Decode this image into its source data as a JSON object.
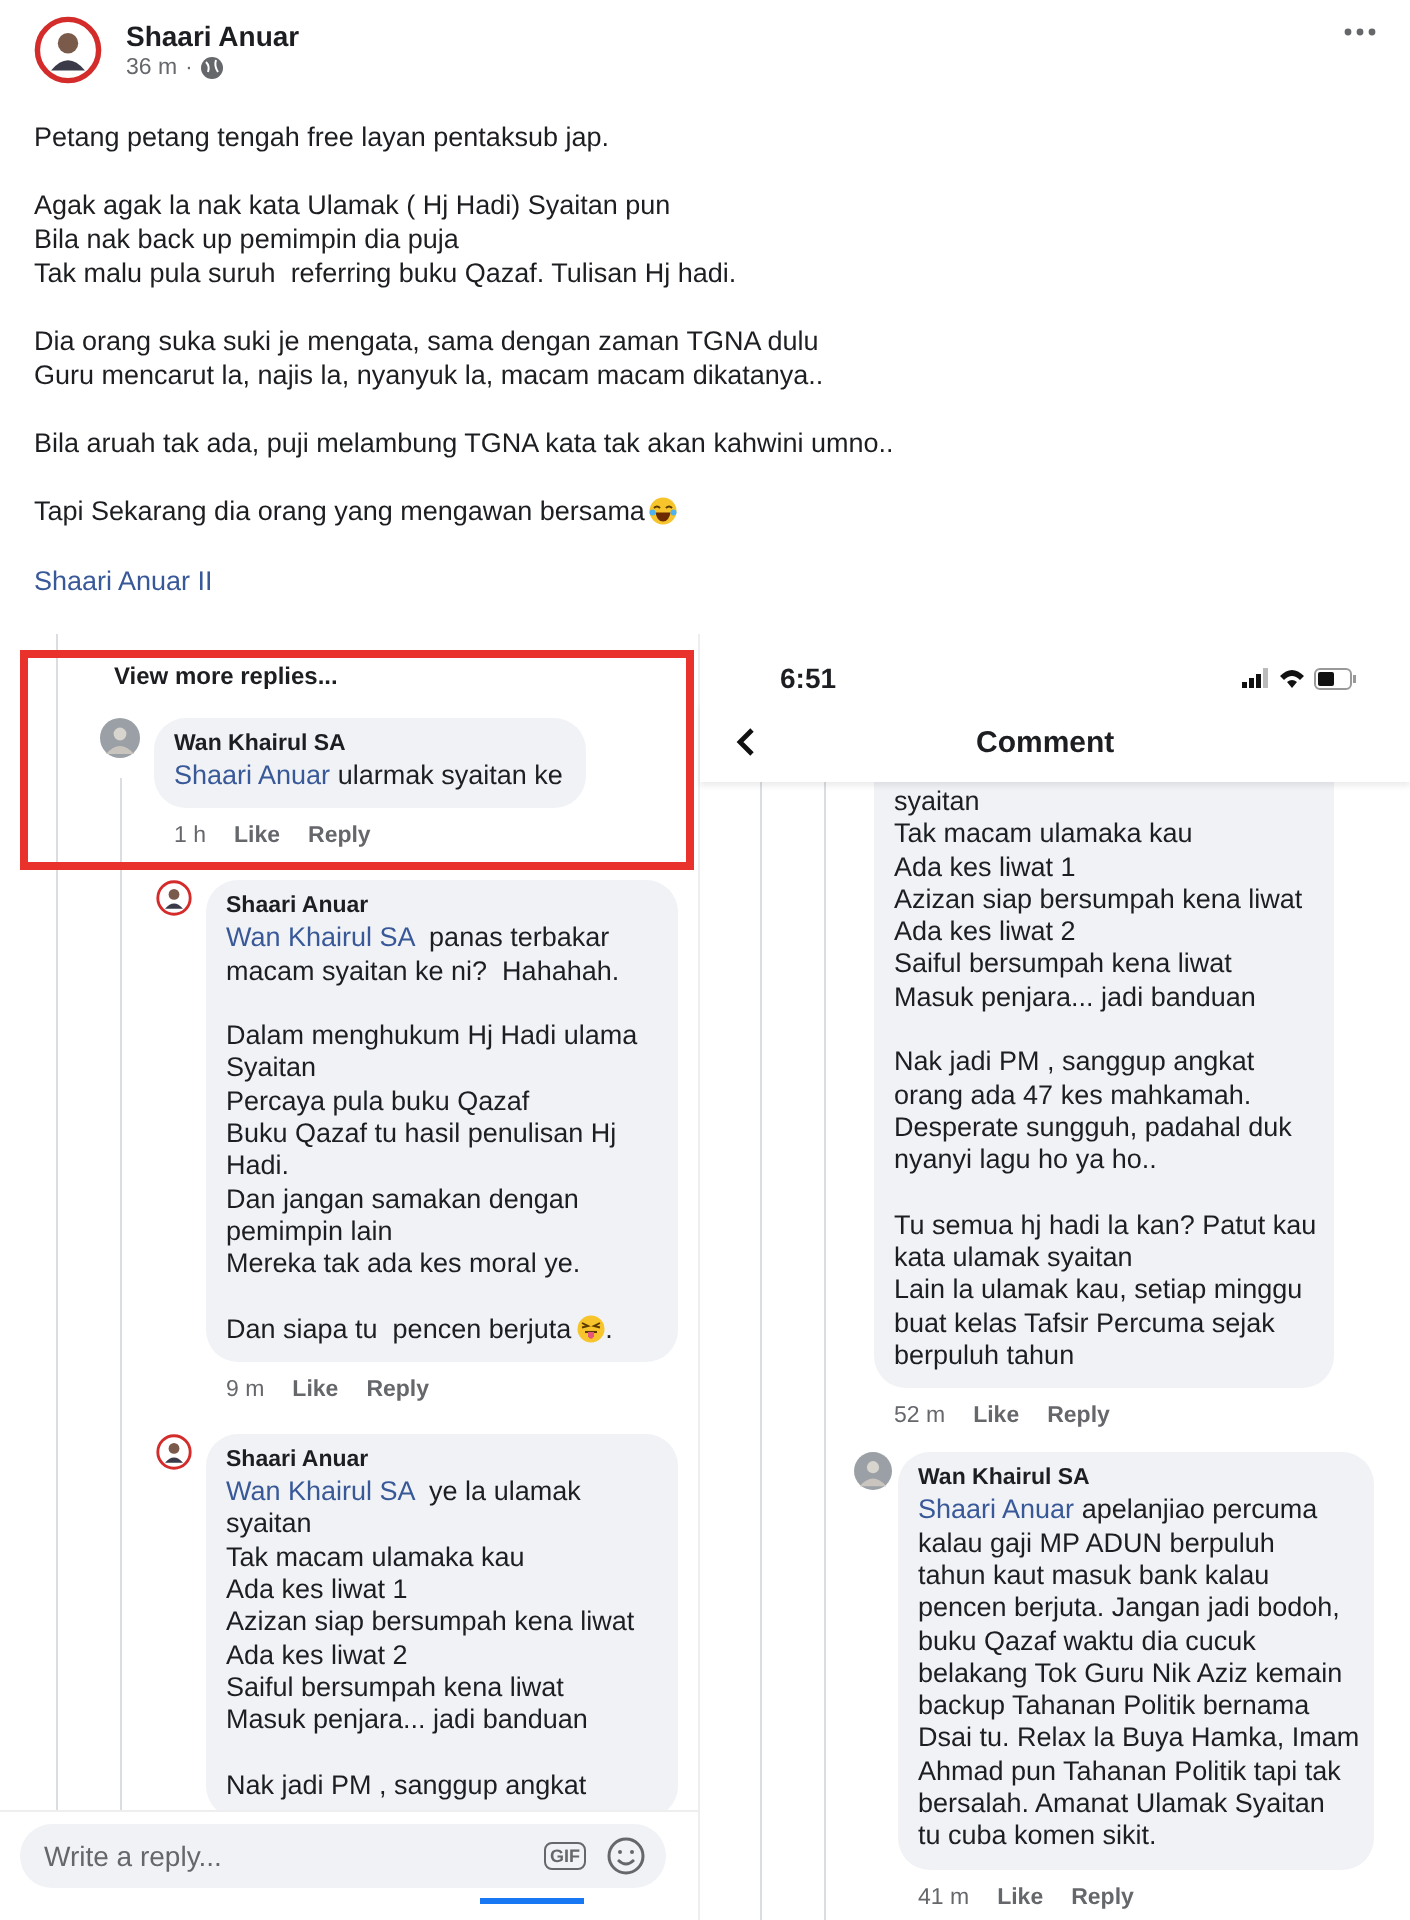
{
  "post": {
    "author": "Shaari Anuar",
    "time": "36 m",
    "separator": "·",
    "paragraphs": [
      {
        "lines": [
          "Petang petang tengah free layan pentaksub jap."
        ]
      },
      {
        "lines": [
          "Agak agak la nak kata Ulamak ( Hj Hadi) Syaitan pun",
          "Bila nak back up pemimpin dia puja",
          "Tak malu pula suruh  referring buku Qazaf. Tulisan Hj hadi."
        ]
      },
      {
        "lines": [
          "Dia orang suka suki je mengata, sama dengan zaman TGNA dulu",
          "Guru mencarut la, najis la, nyanyuk la, macam macam dikatanya.."
        ]
      },
      {
        "lines": [
          "Bila aruah tak ada, puji melambung TGNA kata tak akan kahwini umno.."
        ]
      },
      {
        "lines": [
          "Tapi Sekarang dia orang yang mengawan bersama"
        ],
        "emoji": {
          "kind": "laughing"
        }
      }
    ],
    "link": "Shaari Anuar II"
  },
  "left_screenshot": {
    "view_more": "View more replies...",
    "highlighted": true,
    "comments": [
      {
        "author": "Wan Khairul SA",
        "avatar": {
          "kind": "photo"
        },
        "mention": "Shaari Anuar",
        "paragraphs": [
          {
            "lines": [
              " ularmak syaitan ke"
            ]
          }
        ],
        "time": "1 h",
        "actions": [
          "Like",
          "Reply"
        ],
        "replies": [
          {
            "author": "Shaari Anuar",
            "avatar": {
              "kind": "ring"
            },
            "mention": "Wan Khairul SA",
            "paragraphs": [
              {
                "lines": [
                  "  panas terbakar",
                  "macam syaitan ke ni?  Hahahah."
                ]
              },
              {
                "lines": [
                  "Dalam menghukum Hj Hadi ulama",
                  "Syaitan",
                  "Percaya pula buku Qazaf",
                  "Buku Qazaf tu hasil penulisan Hj",
                  "Hadi.",
                  "Dan jangan samakan dengan",
                  "pemimpin lain",
                  "Mereka tak ada kes moral ye."
                ]
              },
              {
                "lines": [
                  "Dan siapa tu  pencen berjuta"
                ],
                "emoji": {
                  "kind": "tongue"
                },
                "tail": "."
              }
            ],
            "time": "9 m",
            "actions": [
              "Like",
              "Reply"
            ]
          },
          {
            "author": "Shaari Anuar",
            "avatar": {
              "kind": "ring"
            },
            "mention": "Wan Khairul SA",
            "paragraphs": [
              {
                "lines": [
                  "  ye la ulamak",
                  "syaitan",
                  "Tak macam ulamaka kau",
                  "Ada kes liwat 1",
                  "Azizan siap bersumpah kena liwat",
                  "Ada kes liwat 2",
                  "Saiful bersumpah kena liwat",
                  "Masuk penjara... jadi banduan"
                ]
              },
              {
                "lines": [
                  "Nak jadi PM , sanggup angkat"
                ]
              }
            ]
          }
        ]
      }
    ],
    "reply_field": {
      "placeholder": "Write a reply...",
      "gif": "GIF"
    }
  },
  "right_screenshot": {
    "time": "6:51",
    "title": "Comment",
    "comments": [
      {
        "paragraphs": [
          {
            "lines": [
              "syaitan",
              "Tak macam ulamaka kau",
              "Ada kes liwat 1",
              "Azizan siap bersumpah kena liwat",
              "Ada kes liwat 2",
              "Saiful bersumpah kena liwat",
              "Masuk penjara... jadi banduan"
            ]
          },
          {
            "lines": [
              "Nak jadi PM , sanggup angkat",
              "orang ada 47 kes mahkamah.",
              "Desperate sungguh, padahal duk",
              "nyanyi lagu ho ya ho.."
            ]
          },
          {
            "lines": [
              "Tu semua hj hadi la kan? Patut kau",
              "kata ulamak syaitan",
              "Lain la ulamak kau, setiap minggu",
              "buat kelas Tafsir Percuma sejak",
              "berpuluh tahun"
            ]
          }
        ],
        "time": "52 m",
        "actions": [
          "Like",
          "Reply"
        ]
      },
      {
        "author": "Wan Khairul SA",
        "avatar": {
          "kind": "photo"
        },
        "mention": "Shaari Anuar",
        "paragraphs": [
          {
            "lines": [
              " apelanjiao percuma",
              "kalau gaji MP ADUN berpuluh",
              "tahun kaut masuk bank kalau",
              "pencen berjuta. Jangan jadi bodoh,",
              "buku Qazaf waktu dia cucuk",
              "belakang Tok Guru Nik Aziz kemain",
              "backup Tahanan Politik bernama",
              "Dsai tu. Relax la Buya Hamka, Imam",
              "Ahmad pun Tahanan Politik tapi tak",
              "bersalah. Amanat Ulamak Syaitan",
              "tu cuba komen sikit."
            ]
          }
        ],
        "time": "41 m",
        "actions": [
          "Like",
          "Reply"
        ]
      }
    ]
  }
}
